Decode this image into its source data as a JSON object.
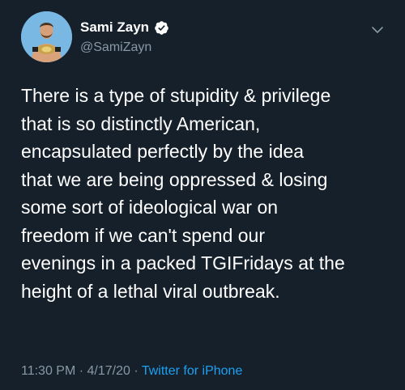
{
  "user": {
    "display_name": "Sami Zayn",
    "handle": "@SamiZayn",
    "verified": true,
    "avatar_icon": "profile-photo-wrestler-with-championship-belt"
  },
  "tweet": {
    "lines": [
      "There is a type of stupidity & privilege",
      "that is so distinctly American,",
      "encapsulated perfectly by the idea",
      "that we are being oppressed & losing",
      "some sort of ideological war on",
      "freedom if we can't spend our",
      "evenings in a packed TGIFridays at the",
      "height of a lethal viral outbreak."
    ]
  },
  "meta": {
    "time": "11:30 PM",
    "separator": " · ",
    "date": "4/17/20",
    "source": "Twitter for iPhone"
  },
  "colors": {
    "background": "#15202b",
    "text": "#ffffff",
    "secondary": "#8899a6",
    "accent": "#1da1f2"
  },
  "icons": {
    "verified": "verified-badge-icon",
    "menu": "chevron-down-icon"
  }
}
